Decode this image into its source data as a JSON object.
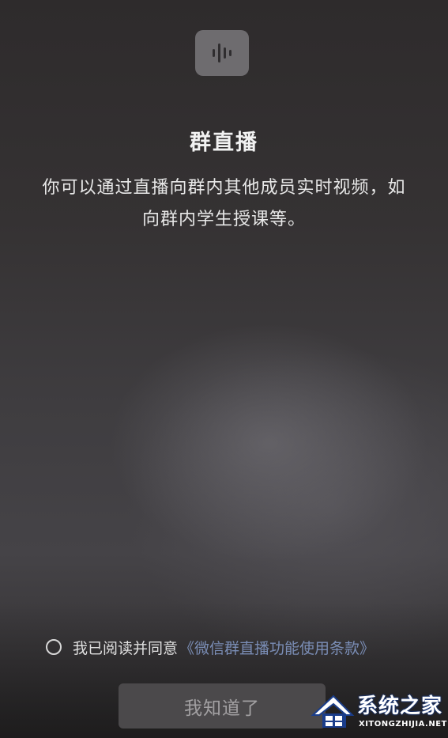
{
  "dialog": {
    "icon": "voice-wave-icon",
    "title": "群直播",
    "description_lines": [
      "你可以通过直播向群内其他成员实时视频，如",
      "向群内学生授课等。"
    ]
  },
  "agreement": {
    "text": "我已阅读并同意",
    "link": "《微信群直播功能使用条款》",
    "checked": false
  },
  "confirm_button": {
    "label": "我知道了"
  },
  "watermark": {
    "title": "系统之家",
    "subtitle": "XITONGZHIJIA.NET"
  },
  "colors": {
    "link": "#7a8db5",
    "button_bg": "#4b494b",
    "button_text": "#a2a0a2"
  }
}
